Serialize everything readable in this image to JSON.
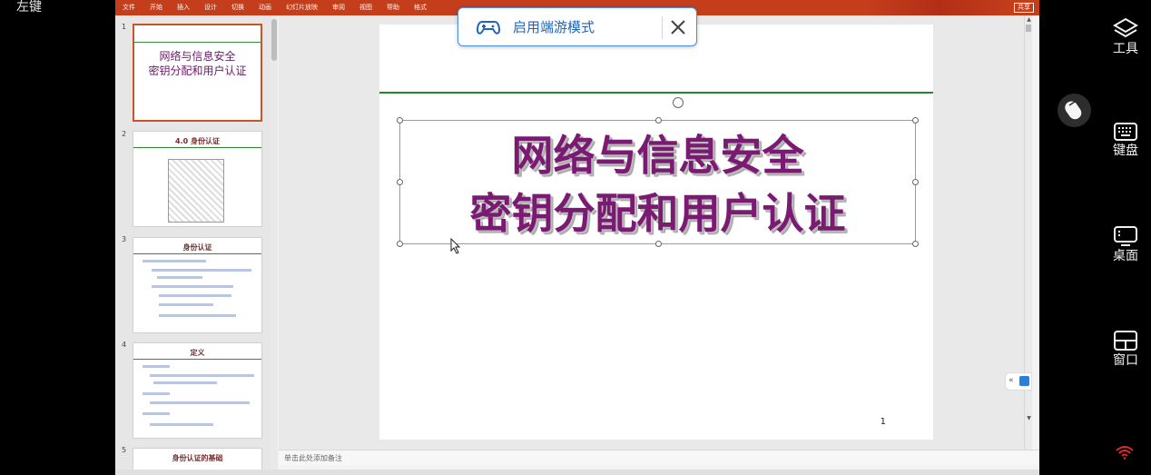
{
  "left_key_label": "左键",
  "ribbon": {
    "tabs": [
      "文件",
      "开始",
      "插入",
      "设计",
      "切换",
      "动画",
      "幻灯片放映",
      "审阅",
      "视图",
      "帮助",
      "格式"
    ],
    "share": "共享"
  },
  "thumbnails": [
    {
      "number": "1",
      "title_line1": "网络与信息安全",
      "title_line2": "密钥分配和用户认证"
    },
    {
      "number": "2",
      "title": "4.0 身份认证"
    },
    {
      "number": "3",
      "title": "身份认证"
    },
    {
      "number": "4",
      "title": "定义"
    },
    {
      "number": "5",
      "title": "身份认证的基础"
    }
  ],
  "slide": {
    "title_line1": "网络与信息安全",
    "title_line2": "密钥分配和用户认证",
    "page_number": "1"
  },
  "notes_placeholder": "单击此处添加备注",
  "toast": {
    "label": "启用端游模式",
    "icon": "gamepad-icon",
    "close_icon": "close-icon"
  },
  "sidebar": {
    "items": [
      {
        "label": "工具",
        "icon": "layers-icon"
      },
      {
        "label": "键盘",
        "icon": "keyboard-icon"
      },
      {
        "label": "桌面",
        "icon": "desktop-icon"
      },
      {
        "label": "窗口",
        "icon": "window-grid-icon"
      }
    ],
    "mouse_icon": "mouse-icon",
    "wifi_icon": "wifi-icon"
  },
  "colors": {
    "ribbon": "#c43e1c",
    "title_purple": "#7a1a72",
    "slide_rule_green": "#1f8a2a",
    "toast_blue": "#1f63c2",
    "wifi_red": "#e02a2a"
  }
}
